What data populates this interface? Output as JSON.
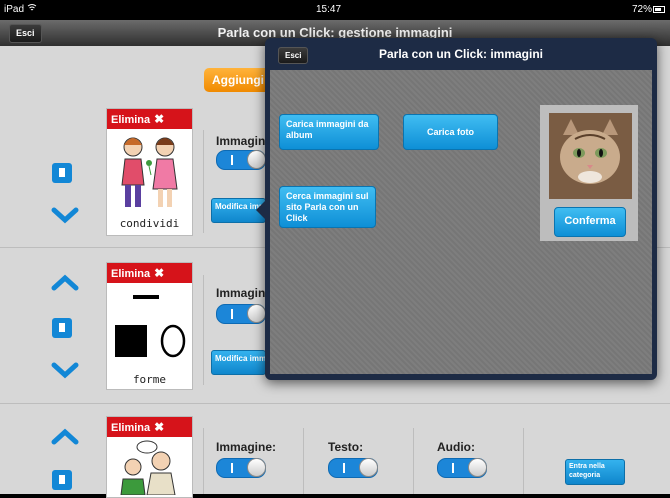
{
  "statusbar": {
    "device": "iPad",
    "time": "15:47",
    "battery": "72%"
  },
  "navbar": {
    "esc_label": "Esci",
    "title": "Parla con un Click: gestione immagini"
  },
  "main": {
    "add_label": "Aggiungi",
    "rows": [
      {
        "delete_label": "Elimina",
        "card_label": "condividi",
        "image_label": "Immagine:",
        "edit_label": "Modifica immagine"
      },
      {
        "delete_label": "Elimina",
        "card_label": "forme",
        "image_label": "Immagine:",
        "edit_label": "Modifica immagine"
      },
      {
        "delete_label": "Elimina",
        "card_label": "",
        "image_label": "Immagine:",
        "text_label": "Testo:",
        "audio_label": "Audio:",
        "enter_label": "Entra nella categoria"
      }
    ]
  },
  "popover": {
    "esc_label": "Esci",
    "title": "Parla con un Click: immagini",
    "load_album_label": "Carica immagini da album",
    "load_photo_label": "Carica foto",
    "search_site_label": "Cerca immagini sul sito Parla con un Click",
    "confirm_label": "Conferma"
  },
  "colors": {
    "accent_blue": "#1287d6",
    "delete_red": "#d6131a",
    "add_orange": "#f59a10",
    "popover_frame": "#1d2b45"
  }
}
